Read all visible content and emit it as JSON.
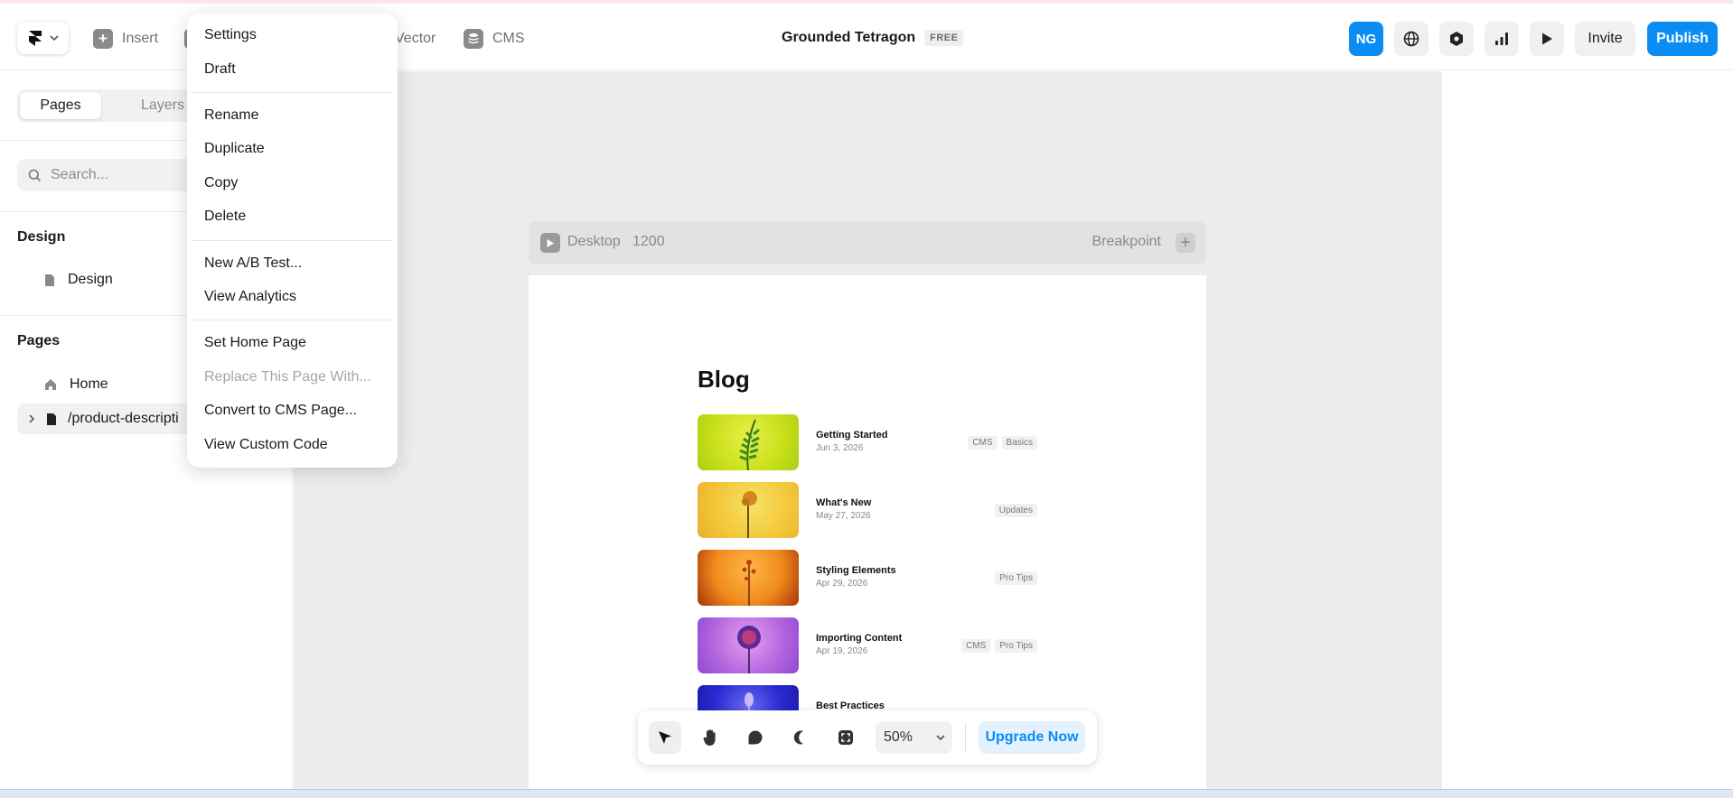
{
  "toolbar": {
    "insert_label": "Insert",
    "vector_label": "Vector",
    "cms_label": "CMS",
    "doc_title": "Grounded Tetragon",
    "plan_badge": "FREE",
    "avatar_initials": "NG",
    "invite_label": "Invite",
    "publish_label": "Publish"
  },
  "sidebar": {
    "tabs": [
      "Pages",
      "Layers"
    ],
    "search_placeholder": "Search...",
    "design_heading": "Design",
    "design_items": [
      "Design"
    ],
    "pages_heading": "Pages",
    "page_items": [
      "Home",
      "/product-descripti"
    ]
  },
  "canvas": {
    "breakpoint_name": "Desktop",
    "breakpoint_width": "1200",
    "breakpoint_label": "Breakpoint",
    "blog_title": "Blog",
    "posts": [
      {
        "title": "Getting Started",
        "date": "Jun 3, 2026",
        "tags": [
          "CMS",
          "Basics"
        ]
      },
      {
        "title": "What's New",
        "date": "May 27, 2026",
        "tags": [
          "Updates"
        ]
      },
      {
        "title": "Styling Elements",
        "date": "Apr 29, 2026",
        "tags": [
          "Pro Tips"
        ]
      },
      {
        "title": "Importing Content",
        "date": "Apr 19, 2026",
        "tags": [
          "CMS",
          "Pro Tips"
        ]
      },
      {
        "title": "Best Practices",
        "date": "",
        "tags": []
      }
    ]
  },
  "bottom_bar": {
    "zoom": "50%",
    "upgrade_label": "Upgrade Now"
  },
  "context_menu": {
    "items": [
      "Settings",
      "Draft",
      "Rename",
      "Duplicate",
      "Copy",
      "Delete",
      "New A/B Test...",
      "View Analytics",
      "Set Home Page",
      "Replace This Page With...",
      "Convert to CMS Page...",
      "View Custom Code"
    ]
  },
  "colors": {
    "accent": "#0a8cf5",
    "canvas_bg": "#ececec"
  }
}
